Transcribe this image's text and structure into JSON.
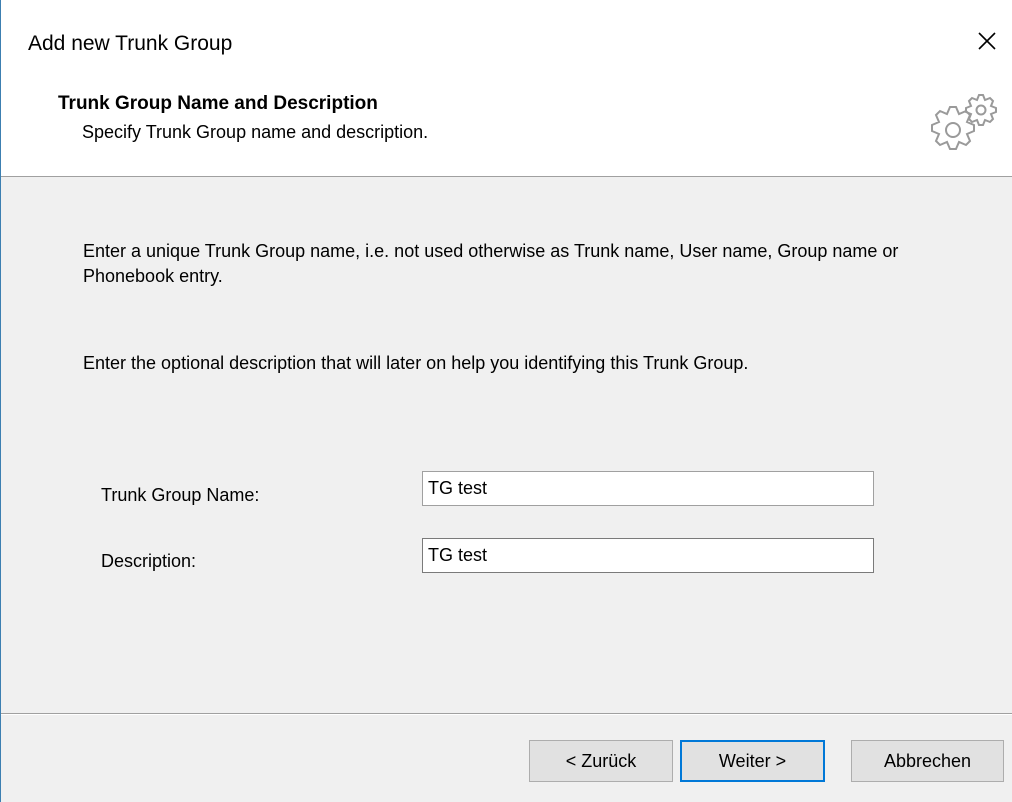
{
  "window": {
    "title": "Add new Trunk Group",
    "close_icon": "close-icon"
  },
  "header": {
    "title": "Trunk Group Name and Description",
    "subtitle": "Specify Trunk Group name and description.",
    "icon": "gears-icon"
  },
  "content": {
    "paragraph1": "Enter a unique Trunk Group name, i.e. not used otherwise as Trunk name, User name, Group name or Phonebook entry.",
    "paragraph2": "Enter the optional description that will later on help you identifying this Trunk Group.",
    "name_label": "Trunk Group Name:",
    "name_value": "TG test",
    "description_label": "Description:",
    "description_value": "TG test"
  },
  "buttons": {
    "back": "< Zurück",
    "next": "Weiter >",
    "cancel": "Abbrechen"
  },
  "colors": {
    "accent": "#0078d7",
    "dialog_bg": "#f0f0f0"
  }
}
